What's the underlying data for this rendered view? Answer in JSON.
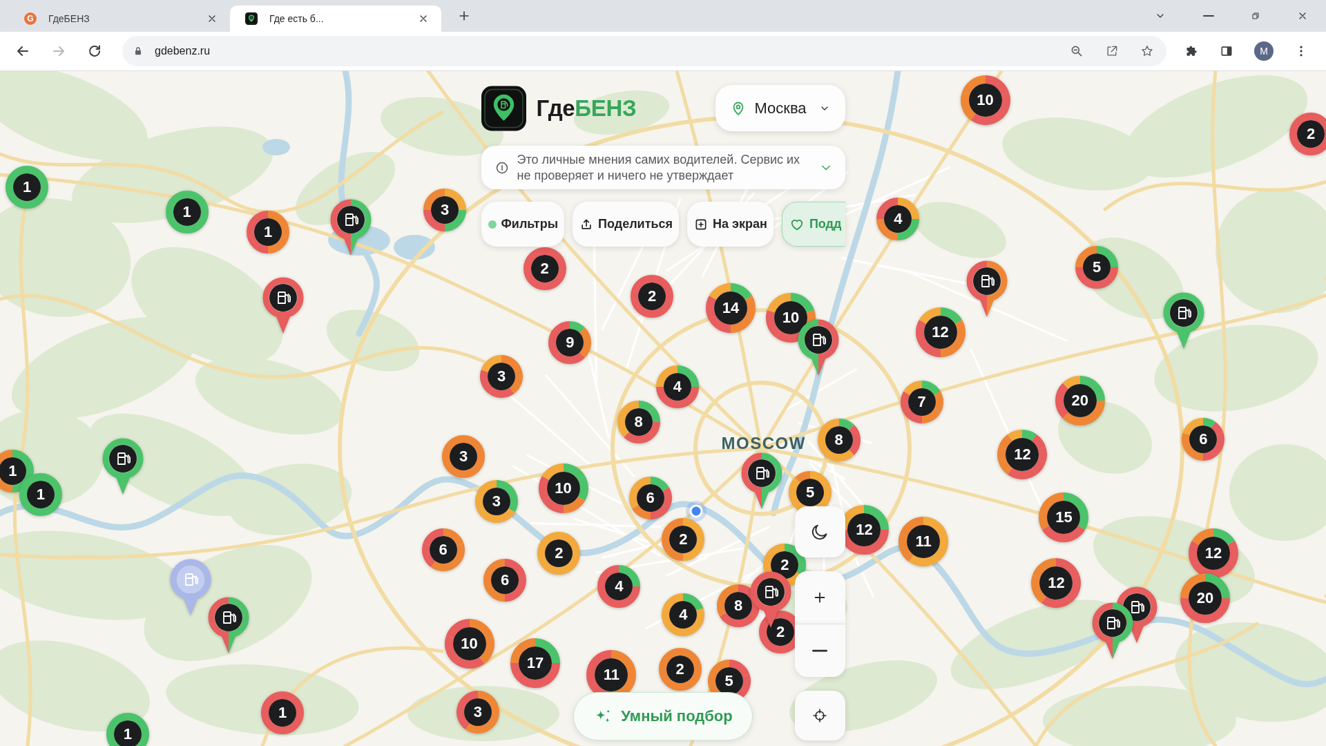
{
  "browser": {
    "tabs": [
      {
        "title": "ГдеБЕНЗ",
        "favicon_text": "G",
        "selected": false
      },
      {
        "title": "Где есть б...",
        "selected": true
      }
    ],
    "back_disabled": false,
    "forward_disabled": true,
    "url": "gdebenz.ru",
    "profile_initial": "M"
  },
  "header": {
    "brand_prefix": "Где",
    "brand_accent": "БЕНЗ",
    "city": "Москва"
  },
  "notice": {
    "text": "Это личные мнения самих водителей. Сервис их не проверяет и ничего не утверждает",
    "expanded": false
  },
  "actions": [
    {
      "kind": "filters",
      "label": "Фильтры"
    },
    {
      "kind": "share",
      "label": "Поделиться"
    },
    {
      "kind": "add",
      "label": "На экран"
    },
    {
      "kind": "support",
      "label": "Подд"
    }
  ],
  "map": {
    "label": "MOSCOW",
    "clusters": [
      {
        "count": "10",
        "segments": [
          {
            "color": "#e85d5d"
          },
          {
            "color": "#e85d5d"
          },
          {
            "color": "#e85d5d"
          },
          {
            "color": "#ef8636"
          },
          {
            "color": "#ef8636"
          }
        ]
      },
      {
        "count": "2",
        "segments": [
          {
            "color": "#e85d5d"
          }
        ]
      },
      {
        "count": "1",
        "segments": [
          {
            "color": "#4bc36b"
          }
        ]
      },
      {
        "count": "1",
        "segments": [
          {
            "color": "#4bc36b"
          }
        ]
      },
      {
        "count": "3",
        "segments": [
          {
            "color": "#f3a93c"
          },
          {
            "color": "#4bc36b"
          },
          {
            "color": "#e85d5d"
          },
          {
            "color": "#ef8636"
          }
        ]
      },
      {
        "count": "4",
        "segments": [
          {
            "color": "#f3a93c"
          },
          {
            "color": "#4bc36b"
          },
          {
            "color": "#ef8636"
          },
          {
            "color": "#e85d5d"
          }
        ]
      },
      {
        "count": "1",
        "segments": [
          {
            "color": "#ef8636"
          },
          {
            "color": "#e85d5d"
          }
        ]
      },
      {
        "count": "2",
        "segments": [
          {
            "color": "#e85d5d"
          }
        ]
      },
      {
        "count": "5",
        "segments": [
          {
            "color": "#4bc36b"
          },
          {
            "color": "#e85d5d"
          },
          {
            "color": "#e85d5d"
          },
          {
            "color": "#ef8636"
          }
        ]
      },
      {
        "count": "2",
        "segments": [
          {
            "color": "#e85d5d"
          }
        ]
      },
      {
        "count": "14",
        "segments": [
          {
            "color": "#4bc36b"
          },
          {
            "color": "#ef8636"
          },
          {
            "color": "#ef8636"
          },
          {
            "color": "#e85d5d"
          },
          {
            "color": "#e85d5d"
          },
          {
            "color": "#f3a93c"
          }
        ]
      },
      {
        "count": "10",
        "segments": [
          {
            "color": "#4bc36b"
          },
          {
            "color": "#ef8636"
          },
          {
            "color": "#e85d5d"
          },
          {
            "color": "#e85d5d"
          },
          {
            "color": "#f3a93c"
          }
        ]
      },
      {
        "count": "12",
        "segments": [
          {
            "color": "#4bc36b"
          },
          {
            "color": "#ef8636"
          },
          {
            "color": "#ef8636"
          },
          {
            "color": "#e85d5d"
          },
          {
            "color": "#e85d5d"
          },
          {
            "color": "#f3a93c"
          }
        ]
      },
      {
        "count": "9",
        "segments": [
          {
            "color": "#4bc36b"
          },
          {
            "color": "#ef8636"
          },
          {
            "color": "#ef8636"
          },
          {
            "color": "#e85d5d"
          },
          {
            "color": "#e85d5d"
          },
          {
            "color": "#e85d5d"
          },
          {
            "color": "#e85d5d"
          },
          {
            "color": "#e85d5d"
          }
        ]
      },
      {
        "count": "3",
        "segments": [
          {
            "color": "#ef8636"
          },
          {
            "color": "#ef8636"
          },
          {
            "color": "#e85d5d"
          },
          {
            "color": "#e85d5d"
          },
          {
            "color": "#f3a93c"
          }
        ]
      },
      {
        "count": "4",
        "segments": [
          {
            "color": "#4bc36b"
          },
          {
            "color": "#e85d5d"
          },
          {
            "color": "#e85d5d"
          },
          {
            "color": "#f3a93c"
          }
        ]
      },
      {
        "count": "7",
        "segments": [
          {
            "color": "#4bc36b"
          },
          {
            "color": "#ef8636"
          },
          {
            "color": "#ef8636"
          },
          {
            "color": "#e85d5d"
          },
          {
            "color": "#e85d5d"
          },
          {
            "color": "#f3a93c"
          }
        ]
      },
      {
        "count": "20",
        "segments": [
          {
            "color": "#4bc36b"
          },
          {
            "color": "#4bc36b"
          },
          {
            "color": "#ef8636"
          },
          {
            "color": "#ef8636"
          },
          {
            "color": "#ef8636"
          },
          {
            "color": "#e85d5d"
          },
          {
            "color": "#e85d5d"
          },
          {
            "color": "#f3a93c"
          }
        ]
      },
      {
        "count": "8",
        "segments": [
          {
            "color": "#4bc36b"
          },
          {
            "color": "#4bc36b"
          },
          {
            "color": "#e85d5d"
          },
          {
            "color": "#e85d5d"
          },
          {
            "color": "#e85d5d"
          },
          {
            "color": "#f3a93c"
          },
          {
            "color": "#f3a93c"
          },
          {
            "color": "#f3a93c"
          }
        ]
      },
      {
        "count": "8",
        "segments": [
          {
            "color": "#4bc36b"
          },
          {
            "color": "#e85d5d"
          },
          {
            "color": "#e85d5d"
          },
          {
            "color": "#f3a93c"
          },
          {
            "color": "#f3a93c"
          },
          {
            "color": "#f3a93c"
          },
          {
            "color": "#f3a93c"
          },
          {
            "color": "#f3a93c"
          }
        ]
      },
      {
        "count": "12",
        "segments": [
          {
            "color": "#4bc36b"
          },
          {
            "color": "#e85d5d"
          },
          {
            "color": "#e85d5d"
          },
          {
            "color": "#e85d5d"
          },
          {
            "color": "#e85d5d"
          },
          {
            "color": "#e85d5d"
          },
          {
            "color": "#ef8636"
          },
          {
            "color": "#ef8636"
          },
          {
            "color": "#ef8636"
          },
          {
            "color": "#f3a93c"
          }
        ]
      },
      {
        "count": "6",
        "segments": [
          {
            "color": "#4bc36b"
          },
          {
            "color": "#e85d5d"
          },
          {
            "color": "#e85d5d"
          },
          {
            "color": "#e85d5d"
          },
          {
            "color": "#e85d5d"
          },
          {
            "color": "#ef8636"
          },
          {
            "color": "#ef8636"
          },
          {
            "color": "#ef8636"
          },
          {
            "color": "#f3a93c"
          },
          {
            "color": "#f3a93c"
          }
        ]
      },
      {
        "count": "1",
        "segments": [
          {
            "color": "#4bc36b"
          },
          {
            "color": "#ef8636"
          }
        ]
      },
      {
        "count": "3",
        "segments": [
          {
            "color": "#ef8636"
          }
        ]
      },
      {
        "count": "1",
        "segments": [
          {
            "color": "#4bc36b"
          }
        ]
      },
      {
        "count": "3",
        "segments": [
          {
            "color": "#4bc36b"
          },
          {
            "color": "#f3a93c"
          },
          {
            "color": "#f3a93c"
          }
        ]
      },
      {
        "count": "10",
        "segments": [
          {
            "color": "#4bc36b"
          },
          {
            "color": "#4bc36b"
          },
          {
            "color": "#ef8636"
          },
          {
            "color": "#e85d5d"
          },
          {
            "color": "#e85d5d"
          },
          {
            "color": "#f3a93c"
          }
        ]
      },
      {
        "count": "6",
        "segments": [
          {
            "color": "#4bc36b"
          },
          {
            "color": "#e85d5d"
          },
          {
            "color": "#e85d5d"
          },
          {
            "color": "#ef8636"
          },
          {
            "color": "#f3a93c"
          },
          {
            "color": "#f3a93c"
          }
        ]
      },
      {
        "count": "5",
        "segments": [
          {
            "color": "#f3a93c"
          },
          {
            "color": "#f3a93c"
          },
          {
            "color": "#f3a93c"
          },
          {
            "color": "#f3a93c"
          },
          {
            "color": "#f3a93c"
          },
          {
            "color": "#f3a93c"
          },
          {
            "color": "#f3a93c"
          },
          {
            "color": "#ef8636"
          }
        ]
      },
      {
        "count": "12",
        "segments": [
          {
            "color": "#4bc36b"
          },
          {
            "color": "#e85d5d"
          },
          {
            "color": "#e85d5d"
          },
          {
            "color": "#f3a93c"
          }
        ]
      },
      {
        "count": "15",
        "segments": [
          {
            "color": "#4bc36b"
          },
          {
            "color": "#e85d5d"
          },
          {
            "color": "#ef8636"
          }
        ]
      },
      {
        "count": "6",
        "segments": [
          {
            "color": "#ef8636"
          },
          {
            "color": "#ef8636"
          },
          {
            "color": "#ef8636"
          },
          {
            "color": "#e85d5d"
          },
          {
            "color": "#e85d5d"
          }
        ]
      },
      {
        "count": "2",
        "segments": [
          {
            "color": "#f3a93c"
          }
        ]
      },
      {
        "count": "2",
        "segments": [
          {
            "color": "#f3a93c"
          },
          {
            "color": "#ef8636"
          }
        ]
      },
      {
        "count": "11",
        "segments": [
          {
            "color": "#f3a93c"
          },
          {
            "color": "#f3a93c"
          },
          {
            "color": "#f3a93c"
          },
          {
            "color": "#ef8636"
          },
          {
            "color": "#ef8636"
          }
        ]
      },
      {
        "count": "12",
        "segments": [
          {
            "color": "#4bc36b"
          },
          {
            "color": "#e85d5d"
          },
          {
            "color": "#e85d5d"
          },
          {
            "color": "#e85d5d"
          },
          {
            "color": "#e85d5d"
          },
          {
            "color": "#ef8636"
          }
        ]
      },
      {
        "count": "6",
        "segments": [
          {
            "color": "#e85d5d"
          },
          {
            "color": "#ef8636"
          }
        ]
      },
      {
        "count": "2",
        "segments": [
          {
            "color": "#4bc36b"
          },
          {
            "color": "#f3a93c"
          },
          {
            "color": "#f3a93c"
          }
        ]
      },
      {
        "count": "4",
        "segments": [
          {
            "color": "#4bc36b"
          },
          {
            "color": "#e85d5d"
          },
          {
            "color": "#e85d5d"
          },
          {
            "color": "#e85d5d"
          }
        ]
      },
      {
        "count": "12",
        "segments": [
          {
            "color": "#e85d5d"
          },
          {
            "color": "#e85d5d"
          },
          {
            "color": "#e85d5d"
          },
          {
            "color": "#ef8636"
          },
          {
            "color": "#ef8636"
          }
        ]
      },
      {
        "count": "20",
        "segments": [
          {
            "color": "#4bc36b"
          },
          {
            "color": "#e85d5d"
          },
          {
            "color": "#e85d5d"
          },
          {
            "color": "#ef8636"
          }
        ]
      },
      {
        "count": "4",
        "segments": [
          {
            "color": "#4bc36b"
          },
          {
            "color": "#f3a93c"
          },
          {
            "color": "#f3a93c"
          },
          {
            "color": "#f3a93c"
          },
          {
            "color": "#f3a93c"
          }
        ]
      },
      {
        "count": "8",
        "segments": [
          {
            "color": "#e85d5d"
          },
          {
            "color": "#e85d5d"
          },
          {
            "color": "#ef8636"
          }
        ]
      },
      {
        "count": "10",
        "segments": [
          {
            "color": "#ef8636"
          },
          {
            "color": "#ef8636"
          },
          {
            "color": "#e85d5d"
          },
          {
            "color": "#e85d5d"
          },
          {
            "color": "#e85d5d"
          }
        ]
      },
      {
        "count": "2",
        "segments": [
          {
            "color": "#e85d5d"
          }
        ]
      },
      {
        "count": "17",
        "segments": [
          {
            "color": "#4bc36b"
          },
          {
            "color": "#e85d5d"
          },
          {
            "color": "#e85d5d"
          },
          {
            "color": "#ef8636"
          }
        ]
      },
      {
        "count": "11",
        "segments": [
          {
            "color": "#ef8636"
          },
          {
            "color": "#e85d5d"
          }
        ]
      },
      {
        "count": "2",
        "segments": [
          {
            "color": "#ef8636"
          }
        ]
      },
      {
        "count": "5",
        "segments": [
          {
            "color": "#e85d5d"
          },
          {
            "color": "#e85d5d"
          },
          {
            "color": "#e85d5d"
          },
          {
            "color": "#ef8636"
          },
          {
            "color": "#ef8636"
          }
        ]
      },
      {
        "count": "1",
        "segments": [
          {
            "color": "#e85d5d"
          }
        ]
      },
      {
        "count": "3",
        "segments": [
          {
            "color": "#ef8636"
          },
          {
            "color": "#ef8636"
          },
          {
            "color": "#ef8636"
          },
          {
            "color": "#e85d5d"
          },
          {
            "color": "#e85d5d"
          }
        ]
      },
      {
        "count": "1",
        "segments": [
          {
            "color": "#4bc36b"
          }
        ]
      }
    ],
    "pins": [
      {
        "kind": "normal",
        "segments": [
          {
            "color": "#4bc36b"
          },
          {
            "color": "#e85d5d"
          }
        ]
      },
      {
        "kind": "normal",
        "segments": [
          {
            "color": "#ef8636"
          },
          {
            "color": "#e85d5d"
          }
        ]
      },
      {
        "kind": "normal",
        "segments": [
          {
            "color": "#e85d5d"
          }
        ]
      },
      {
        "kind": "normal",
        "segments": [
          {
            "color": "#4bc36b"
          }
        ]
      },
      {
        "kind": "normal",
        "segments": [
          {
            "color": "#e85d5d"
          },
          {
            "color": "#4bc36b"
          }
        ]
      },
      {
        "kind": "normal",
        "segments": [
          {
            "color": "#4bc36b"
          }
        ]
      },
      {
        "kind": "normal",
        "segments": [
          {
            "color": "#4bc36b"
          },
          {
            "color": "#e85d5d"
          }
        ]
      },
      {
        "kind": "muted",
        "segments": [
          {
            "color": "#a9b7ea"
          }
        ]
      },
      {
        "kind": "normal",
        "segments": [
          {
            "color": "#e85d5d"
          }
        ]
      },
      {
        "kind": "normal",
        "segments": [
          {
            "color": "#4bc36b"
          },
          {
            "color": "#e85d5d"
          }
        ]
      },
      {
        "kind": "normal",
        "segments": [
          {
            "color": "#4bc36b"
          },
          {
            "color": "#e85d5d"
          }
        ]
      },
      {
        "kind": "normal",
        "segments": [
          {
            "color": "#e85d5d"
          }
        ]
      }
    ]
  },
  "smart_pick": {
    "label": "Умный подбор"
  }
}
